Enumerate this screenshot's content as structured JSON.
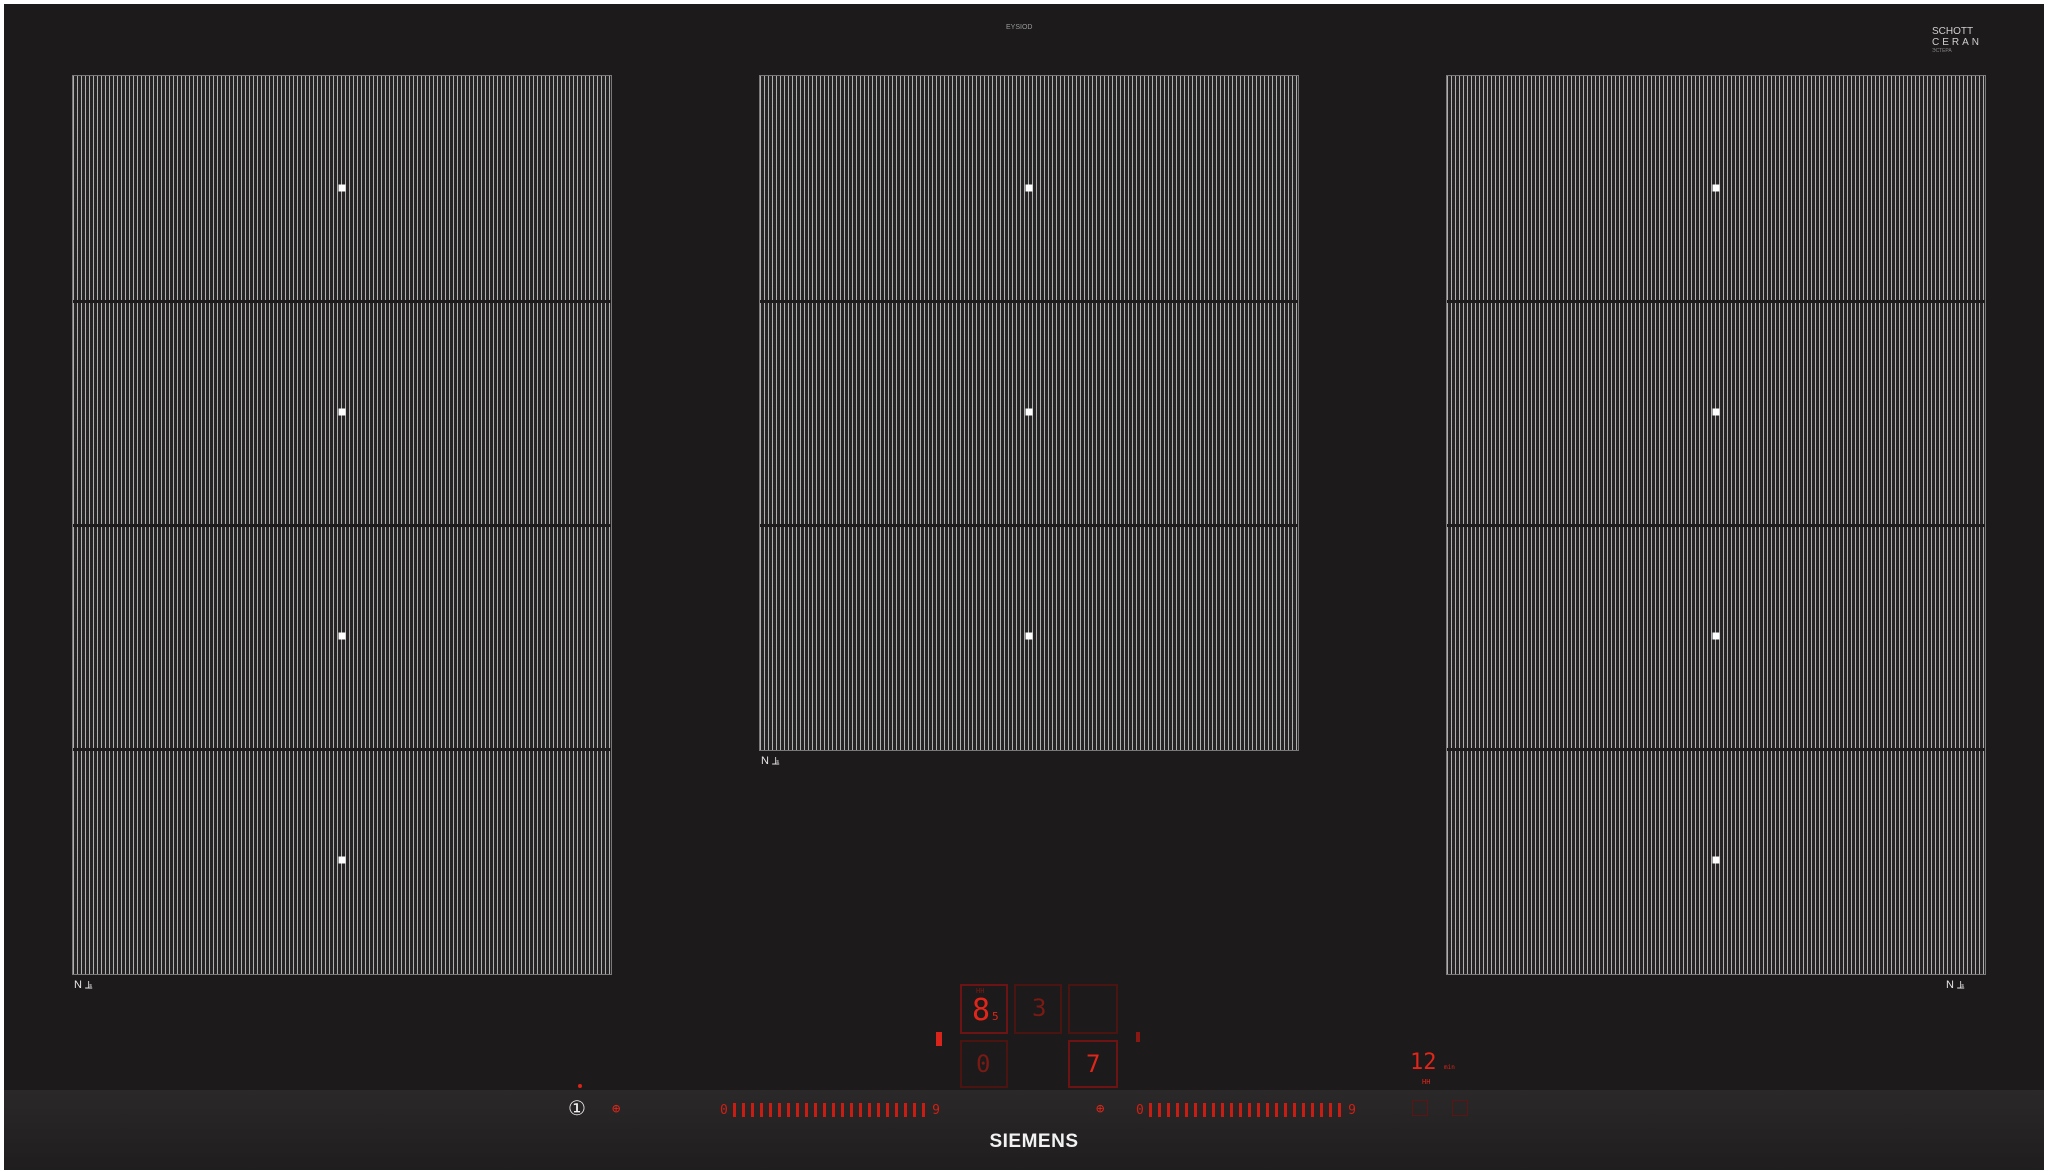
{
  "brand": {
    "name": "SIEMENS",
    "top_label": "EYSIOD",
    "glass_brand_line1": "SCHOTT",
    "glass_brand_line2": "CERAN",
    "glass_brand_sub": "ЭСТЕРА"
  },
  "zones": {
    "left_marker": "N ⫡",
    "center_marker": "N ⫡",
    "right_marker": "N ⫡"
  },
  "display": {
    "power_symbol": "①",
    "main_level": "8",
    "main_level_small": "5",
    "main_level_top": "HH",
    "second_level": "3",
    "lower_left_digit": "0",
    "lower_right_digit": "7",
    "timer_value": "12",
    "timer_unit": "min",
    "timer_sub": "HH",
    "left_slider_start": "0",
    "left_slider_end": "9",
    "right_slider_start": "0",
    "right_slider_end": "9",
    "boost_label": "⊕"
  },
  "colors": {
    "surface": "#1c1a1a",
    "accent_red": "#e0261a",
    "grid_line": "#d7d7d7"
  }
}
